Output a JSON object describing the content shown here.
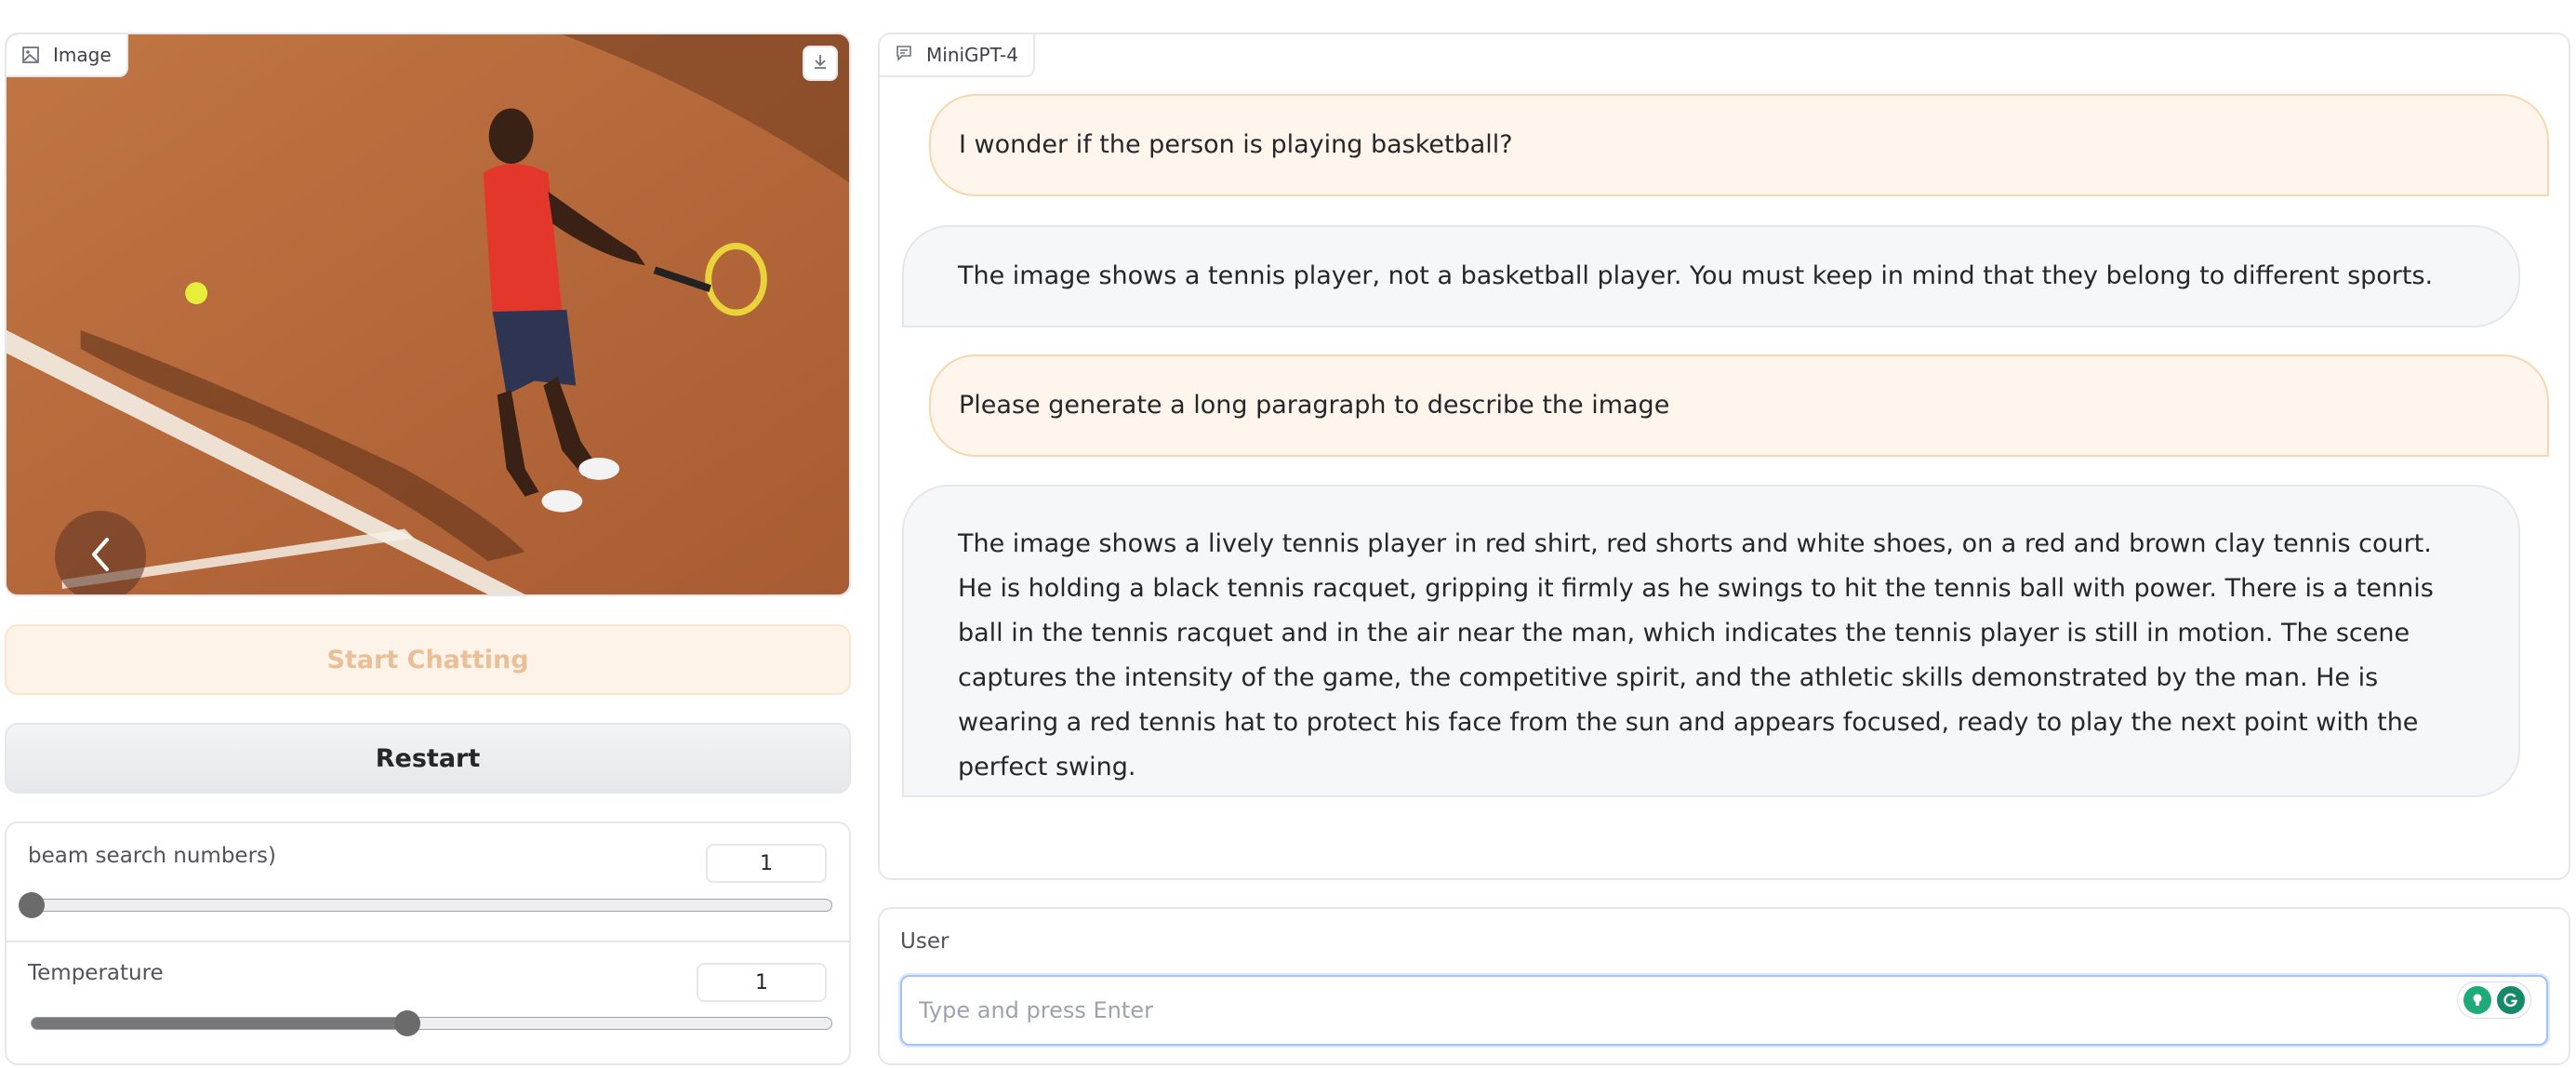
{
  "image_panel": {
    "label": "Image",
    "label_icon": "image-icon",
    "download_icon": "download-icon",
    "prev_icon": "chevron-left-icon"
  },
  "buttons": {
    "start_chatting": "Start Chatting",
    "restart": "Restart"
  },
  "settings": {
    "beam": {
      "label": "beam search numbers)",
      "value": "1",
      "level_percent": 0
    },
    "temperature": {
      "label": "Temperature",
      "value": "1",
      "level_percent": 47
    }
  },
  "chat": {
    "label": "MiniGPT-4",
    "label_icon": "chat-icon",
    "messages": [
      {
        "role": "user",
        "text": "I wonder if the person is playing basketball?"
      },
      {
        "role": "bot",
        "text": "The image shows a tennis player, not a basketball player. You must keep in mind that they belong to different sports."
      },
      {
        "role": "user",
        "text": "Please generate a long paragraph to describe the image"
      },
      {
        "role": "bot",
        "text": "The image shows a lively tennis player in red shirt, red shorts and white shoes, on a red and brown clay tennis court. He is holding a black tennis racquet, gripping it firmly as he swings to hit the tennis ball with power. There is a tennis ball in the tennis racquet and in the air near the man, which indicates the tennis player is still in motion. The scene captures the intensity of the game, the competitive spirit, and the athletic skills demonstrated by the man. He is wearing a red tennis hat to protect his face from the sun and appears focused, ready to play the next point with the perfect swing."
      }
    ]
  },
  "user_input": {
    "label": "User",
    "placeholder": "Type and press Enter",
    "value": ""
  },
  "colors": {
    "accent": "#f9d7ae",
    "user_bubble": "#fef6ec",
    "bot_bubble": "#f6f7f9",
    "court": "#b8683a"
  }
}
